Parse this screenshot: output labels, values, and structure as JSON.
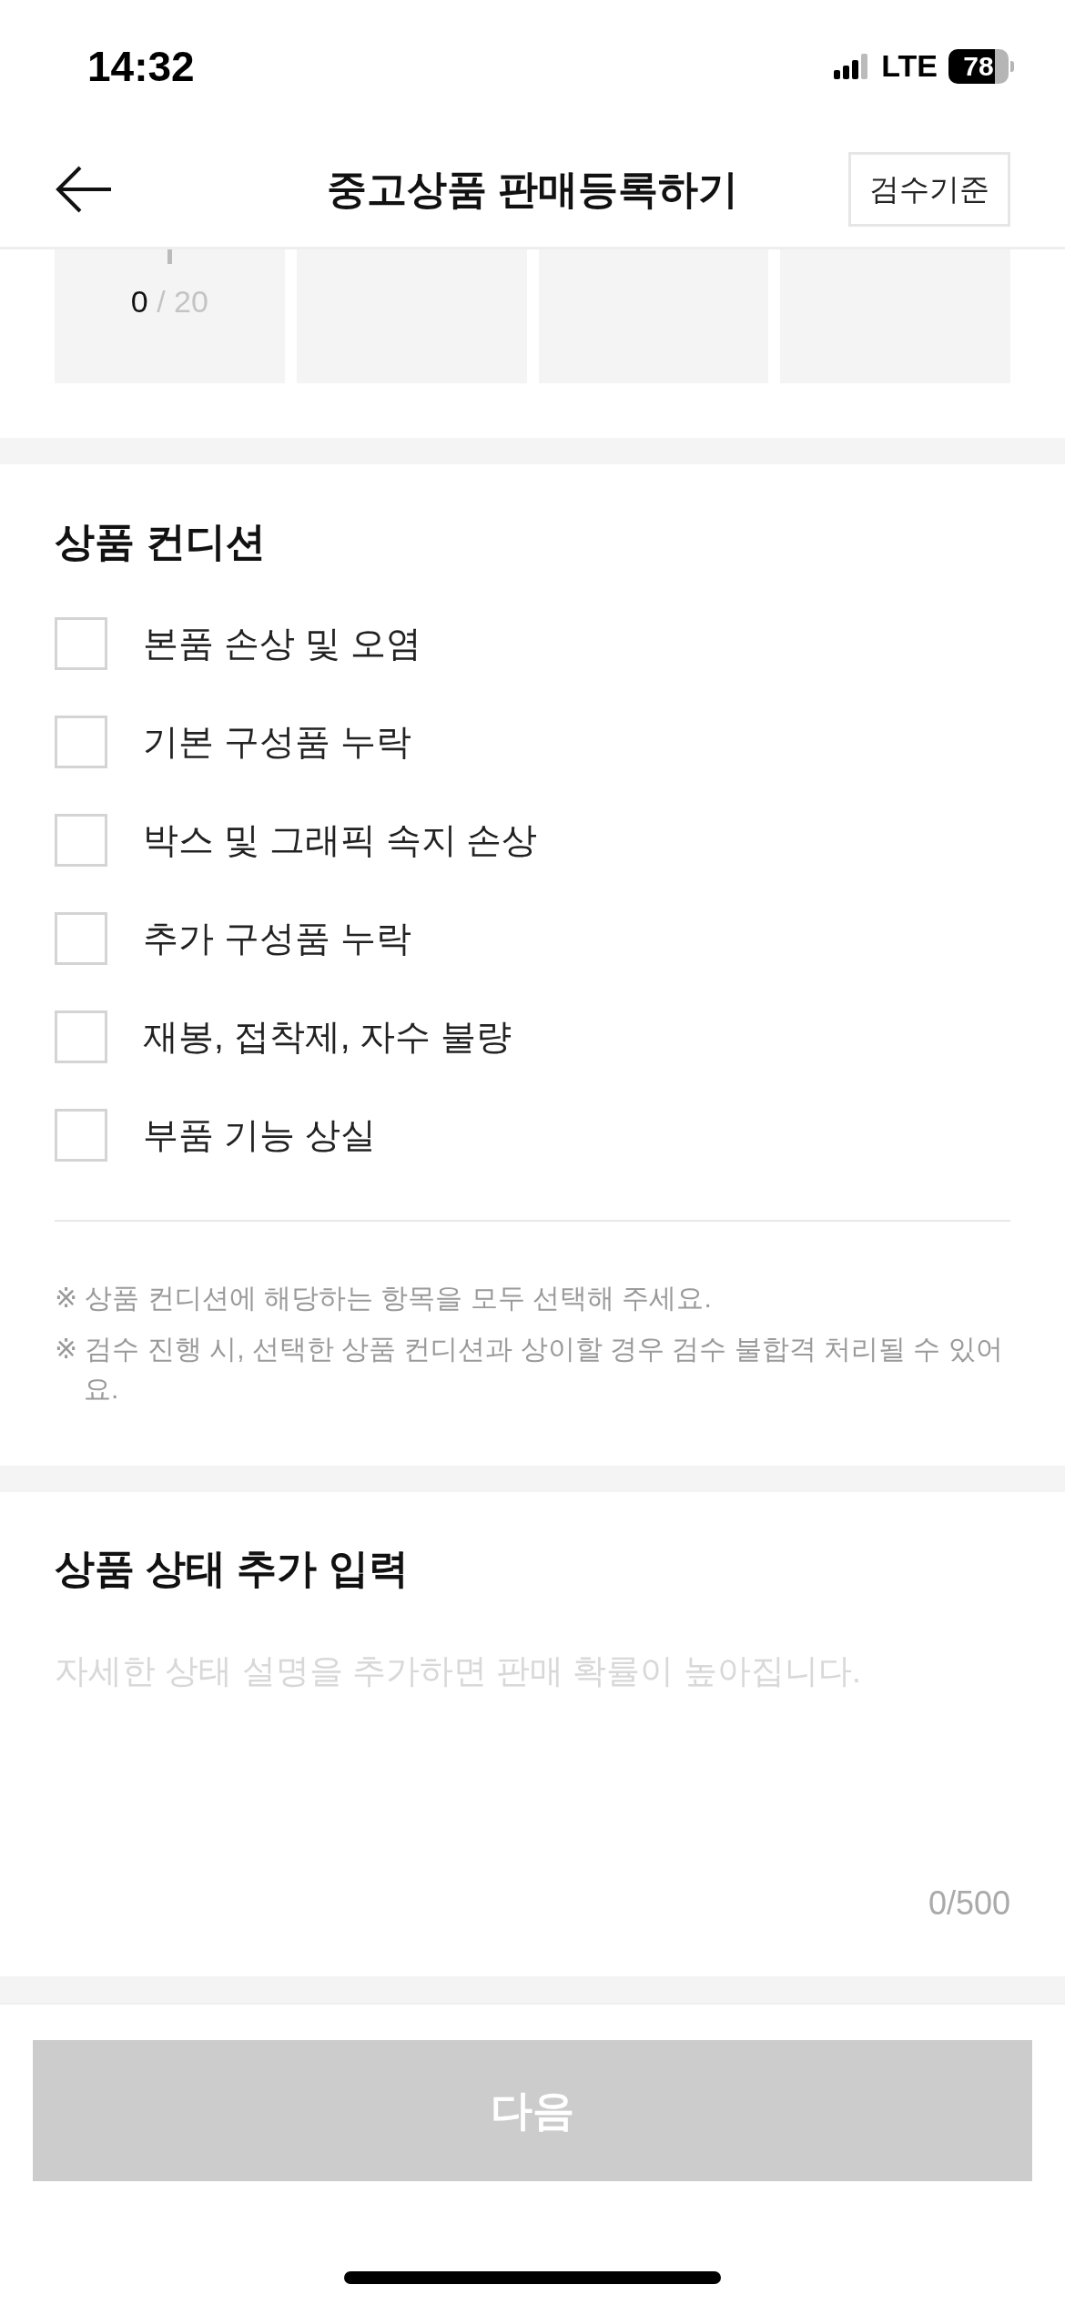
{
  "status_bar": {
    "time": "14:32",
    "network": "LTE",
    "battery": "78"
  },
  "header": {
    "title": "중고상품 판매등록하기",
    "action": "검수기준"
  },
  "photo_slots": [
    {
      "kind": "counter",
      "count": "0",
      "limit": "/ 20"
    },
    {
      "kind": "empty"
    },
    {
      "kind": "empty"
    },
    {
      "kind": "empty"
    }
  ],
  "condition": {
    "title": "상품 컨디션",
    "options": [
      {
        "label": "본품 손상 및 오염",
        "checked": false
      },
      {
        "label": "기본 구성품 누락",
        "checked": false
      },
      {
        "label": "박스 및 그래픽 속지 손상",
        "checked": false
      },
      {
        "label": "추가 구성품 누락",
        "checked": false
      },
      {
        "label": "재봉, 접착제, 자수 불량",
        "checked": false
      },
      {
        "label": "부품 기능 상실",
        "checked": false
      }
    ],
    "notes": [
      "※ 상품 컨디션에 해당하는 항목을 모두 선택해 주세요.",
      "※ 검수 진행 시, 선택한 상품 컨디션과 상이할 경우 검수 불합격 처리될 수 있어요."
    ]
  },
  "additional": {
    "title": "상품 상태 추가 입력",
    "placeholder": "자세한 상태 설명을 추가하면 판매 확률이 높아집니다.",
    "counter": "0/500"
  },
  "next_button": {
    "label": "다음",
    "disabled": true
  }
}
